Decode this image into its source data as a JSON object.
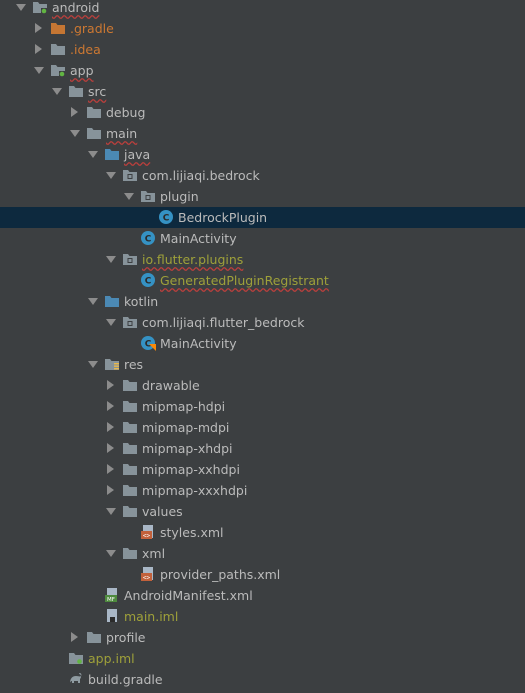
{
  "colors": {
    "background": "#3c3f41",
    "selection": "#0d293e",
    "text": "#bbbbbb",
    "folder": "#87939a",
    "source_folder": "#4b89b4",
    "orange_folder": "#c57633",
    "class_icon": "#3592c4",
    "highlight_text": "#a5a531",
    "error_underline": "#bc3f3c"
  },
  "tree": [
    {
      "label": "android",
      "depth": 0,
      "arrow": "expanded",
      "icon": "module-folder-icon",
      "style": "normal",
      "squiggle": true
    },
    {
      "label": ".gradle",
      "depth": 1,
      "arrow": "collapsed",
      "icon": "orange-folder-icon",
      "style": "orange"
    },
    {
      "label": ".idea",
      "depth": 1,
      "arrow": "collapsed",
      "icon": "folder-icon",
      "style": "orange"
    },
    {
      "label": "app",
      "depth": 1,
      "arrow": "expanded",
      "icon": "module-folder-icon",
      "style": "normal",
      "squiggle": true
    },
    {
      "label": "src",
      "depth": 2,
      "arrow": "expanded",
      "icon": "folder-icon",
      "style": "normal",
      "squiggle": true
    },
    {
      "label": "debug",
      "depth": 3,
      "arrow": "collapsed",
      "icon": "folder-icon",
      "style": "normal"
    },
    {
      "label": "main",
      "depth": 3,
      "arrow": "expanded",
      "icon": "folder-icon",
      "style": "normal",
      "squiggle": true
    },
    {
      "label": "java",
      "depth": 4,
      "arrow": "expanded",
      "icon": "source-folder-icon",
      "style": "normal",
      "squiggle": true
    },
    {
      "label": "com.lijiaqi.bedrock",
      "depth": 5,
      "arrow": "expanded",
      "icon": "package-icon",
      "style": "normal"
    },
    {
      "label": "plugin",
      "depth": 6,
      "arrow": "expanded",
      "icon": "package-icon",
      "style": "normal"
    },
    {
      "label": "BedrockPlugin",
      "depth": 7,
      "arrow": "none",
      "icon": "class-icon",
      "style": "normal",
      "selected": true
    },
    {
      "label": "MainActivity",
      "depth": 6,
      "arrow": "none",
      "icon": "class-icon",
      "style": "normal"
    },
    {
      "label": "io.flutter.plugins",
      "depth": 5,
      "arrow": "expanded",
      "icon": "package-icon",
      "style": "olive",
      "squiggle": true
    },
    {
      "label": "GeneratedPluginRegistrant",
      "depth": 6,
      "arrow": "none",
      "icon": "class-icon",
      "style": "olive",
      "squiggle": true
    },
    {
      "label": "kotlin",
      "depth": 4,
      "arrow": "expanded",
      "icon": "source-folder-icon",
      "style": "normal"
    },
    {
      "label": "com.lijiaqi.flutter_bedrock",
      "depth": 5,
      "arrow": "expanded",
      "icon": "package-icon",
      "style": "normal"
    },
    {
      "label": "MainActivity",
      "depth": 6,
      "arrow": "none",
      "icon": "kotlin-class-icon",
      "style": "normal"
    },
    {
      "label": "res",
      "depth": 4,
      "arrow": "expanded",
      "icon": "resource-folder-icon",
      "style": "normal"
    },
    {
      "label": "drawable",
      "depth": 5,
      "arrow": "collapsed",
      "icon": "folder-icon",
      "style": "normal"
    },
    {
      "label": "mipmap-hdpi",
      "depth": 5,
      "arrow": "collapsed",
      "icon": "folder-icon",
      "style": "normal"
    },
    {
      "label": "mipmap-mdpi",
      "depth": 5,
      "arrow": "collapsed",
      "icon": "folder-icon",
      "style": "normal"
    },
    {
      "label": "mipmap-xhdpi",
      "depth": 5,
      "arrow": "collapsed",
      "icon": "folder-icon",
      "style": "normal"
    },
    {
      "label": "mipmap-xxhdpi",
      "depth": 5,
      "arrow": "collapsed",
      "icon": "folder-icon",
      "style": "normal"
    },
    {
      "label": "mipmap-xxxhdpi",
      "depth": 5,
      "arrow": "collapsed",
      "icon": "folder-icon",
      "style": "normal"
    },
    {
      "label": "values",
      "depth": 5,
      "arrow": "expanded",
      "icon": "folder-icon",
      "style": "normal"
    },
    {
      "label": "styles.xml",
      "depth": 6,
      "arrow": "none",
      "icon": "xml-file-icon",
      "style": "normal"
    },
    {
      "label": "xml",
      "depth": 5,
      "arrow": "expanded",
      "icon": "folder-icon",
      "style": "normal"
    },
    {
      "label": "provider_paths.xml",
      "depth": 6,
      "arrow": "none",
      "icon": "xml-file-icon",
      "style": "normal"
    },
    {
      "label": "AndroidManifest.xml",
      "depth": 4,
      "arrow": "none",
      "icon": "manifest-file-icon",
      "style": "normal"
    },
    {
      "label": "main.iml",
      "depth": 4,
      "arrow": "none",
      "icon": "iml-file-icon",
      "style": "olive"
    },
    {
      "label": "profile",
      "depth": 3,
      "arrow": "collapsed",
      "icon": "folder-icon",
      "style": "normal"
    },
    {
      "label": "app.iml",
      "depth": 2,
      "arrow": "none",
      "icon": "iml-module-icon",
      "style": "olive"
    },
    {
      "label": "build.gradle",
      "depth": 2,
      "arrow": "none",
      "icon": "gradle-file-icon",
      "style": "normal"
    }
  ]
}
